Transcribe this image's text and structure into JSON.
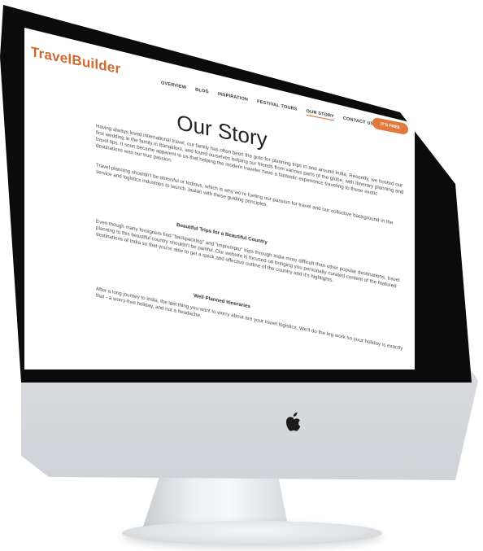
{
  "site": {
    "brand": "TravelBuilder",
    "nav": [
      "OVERVIEW",
      "BLOG",
      "INSPIRATION",
      "FESTIVAL TOURS",
      "OUR STORY",
      "CONTACT US"
    ],
    "active_nav": "OUR STORY",
    "cta": "IT'S FREE"
  },
  "page": {
    "title": "Our Story",
    "paragraph_1": "Having always loved international travel, our family has often been the goto for planning trips in and around India. Recently, we hosted our first wedding in the family in Bangalore, and found ourselves helping our friends from various parts of the globe, with itinerary planning and travel tips. It soon became apparent to us that helping the modern traveler have a fantastic experience traveling to these exotic destinations was our true passion.",
    "paragraph_2": "Travel planning shouldn't be stressful or tedious, which is why we're fueling our passion for travel and our collective background in the service and logistics industries to launch Jaulan with these guiding principles.",
    "subheading_1": "Beautiful Trips for a Beautiful Country",
    "paragraph_3": "Even though many foreigners find \"backpacking\" and \"impromptu\" trips through India more difficult than other popular destinations, travel planning to this beautiful country shouldn't be painful. Our website is focused on bringing you personally curated content of the featured destinations of India so that you're able to get a quick and effective outline of the country and it's highlights.",
    "subheading_2": "Well Planned Itineraries",
    "paragraph_4": "After a long journey to India, the last thing you want to worry about are your travel logistics. We'll do the leg work so your holiday is exactly that - a worry-free holiday, and not a headache."
  },
  "colors": {
    "brand": "#d1682d",
    "cta_background": "#e07a3c",
    "bezel": "#0b0b0c",
    "chin": "#e2e4e7"
  },
  "icons": {
    "hardware_logo": "apple-logo-icon"
  }
}
